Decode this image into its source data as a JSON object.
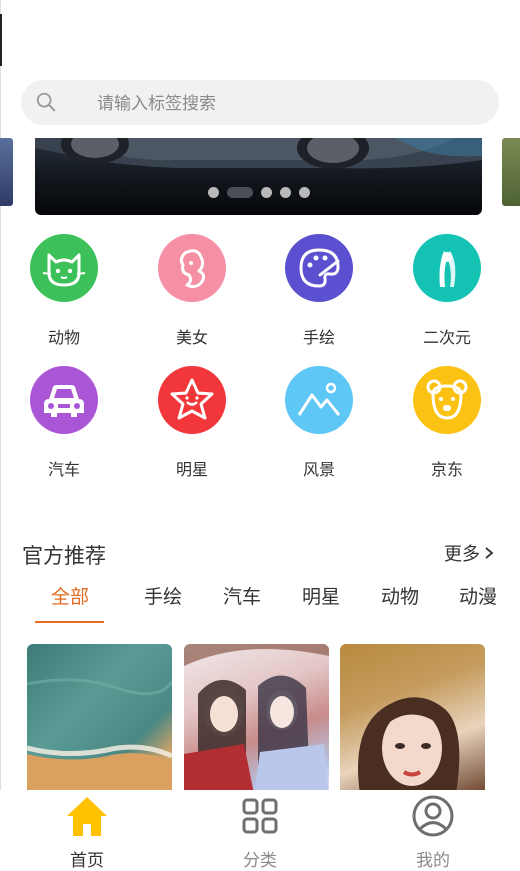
{
  "search": {
    "placeholder": "请输入标签搜索"
  },
  "banner": {
    "dot_count": 5,
    "active_index": 1
  },
  "categories": [
    {
      "label": "动物",
      "icon": "cat-icon",
      "color": "#3cc05a"
    },
    {
      "label": "美女",
      "icon": "woman-icon",
      "color": "#f58fa3"
    },
    {
      "label": "手绘",
      "icon": "palette-icon",
      "color": "#5b50cf"
    },
    {
      "label": "二次元",
      "icon": "anime-icon",
      "color": "#14c3b4"
    },
    {
      "label": "汽车",
      "icon": "car-icon",
      "color": "#a956d6"
    },
    {
      "label": "明星",
      "icon": "star-icon",
      "color": "#f2373a"
    },
    {
      "label": "风景",
      "icon": "landscape-icon",
      "color": "#5fc7f6"
    },
    {
      "label": "京东",
      "icon": "bear-icon",
      "color": "#fbc113"
    }
  ],
  "recommend": {
    "title": "官方推荐",
    "more": "更多",
    "tabs": [
      "全部",
      "手绘",
      "汽车",
      "明星",
      "动物",
      "动漫"
    ],
    "active_tab": 0
  },
  "nav": {
    "items": [
      {
        "label": "首页",
        "icon": "home-icon",
        "active": true
      },
      {
        "label": "分类",
        "icon": "grid-icon",
        "active": false
      },
      {
        "label": "我的",
        "icon": "user-icon",
        "active": false
      }
    ]
  },
  "colors": {
    "accent": "#e46b21",
    "home_active": "#ffc100",
    "search_bg": "#f0f1f3"
  }
}
